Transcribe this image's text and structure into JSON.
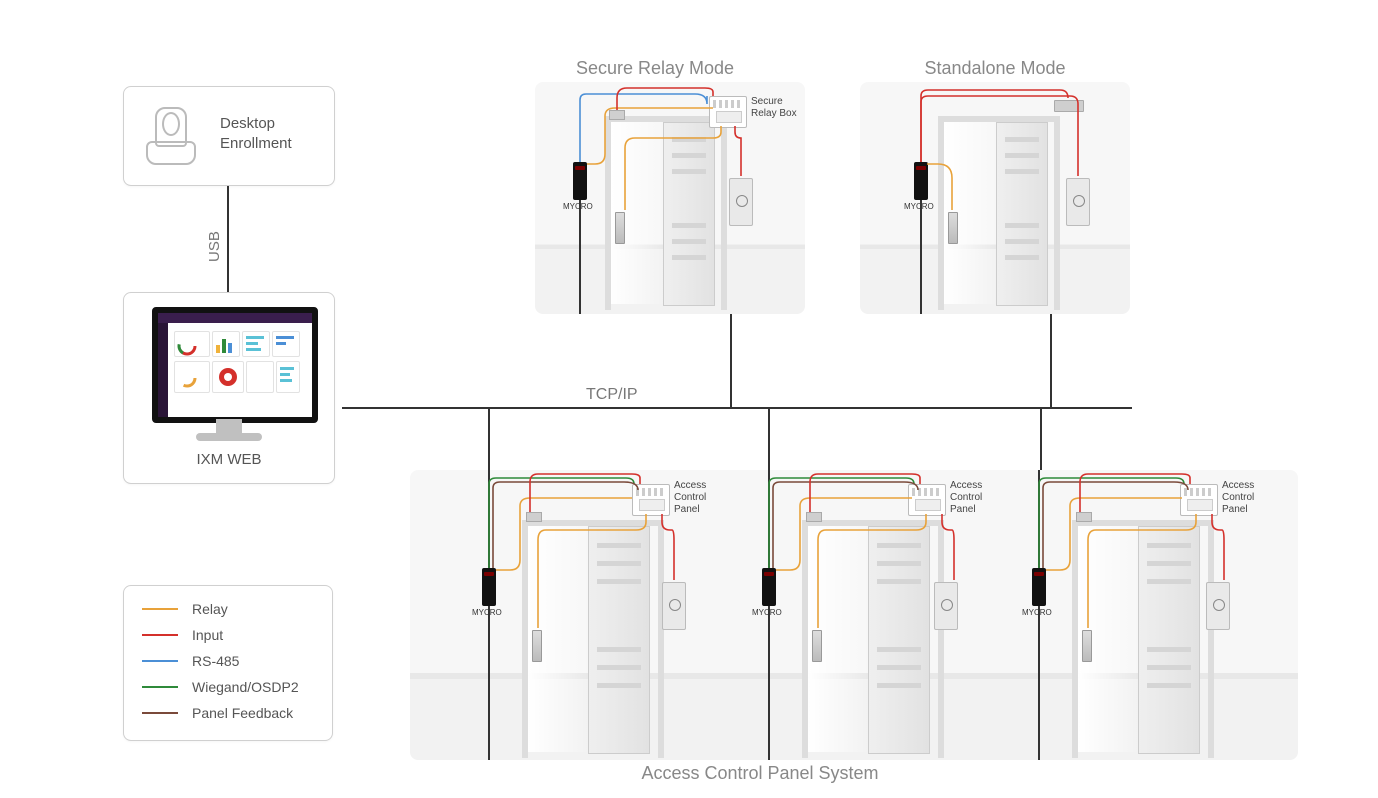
{
  "titles": {
    "secure": "Secure Relay Mode",
    "standalone": "Standalone Mode",
    "acp": "Access Control Panel System"
  },
  "enroll": {
    "label1": "Desktop",
    "label2": "Enrollment"
  },
  "ixm": {
    "label": "IXM WEB"
  },
  "connections": {
    "usb": "USB",
    "tcpip": "TCP/IP"
  },
  "devices": {
    "mycroLabel": "MYCRO",
    "relayBox1": "Secure",
    "relayBox2": "Relay Box",
    "acp1": "Access",
    "acp2": "Control",
    "acp3": "Panel"
  },
  "legend": {
    "items": [
      {
        "label": "Relay",
        "color": "#e8a23a"
      },
      {
        "label": "Input",
        "color": "#d4302b"
      },
      {
        "label": "RS-485",
        "color": "#4b8fd6"
      },
      {
        "label": "Wiegand/OSDP2",
        "color": "#2f8a3a"
      },
      {
        "label": "Panel Feedback",
        "color": "#7a4a3a"
      }
    ]
  }
}
